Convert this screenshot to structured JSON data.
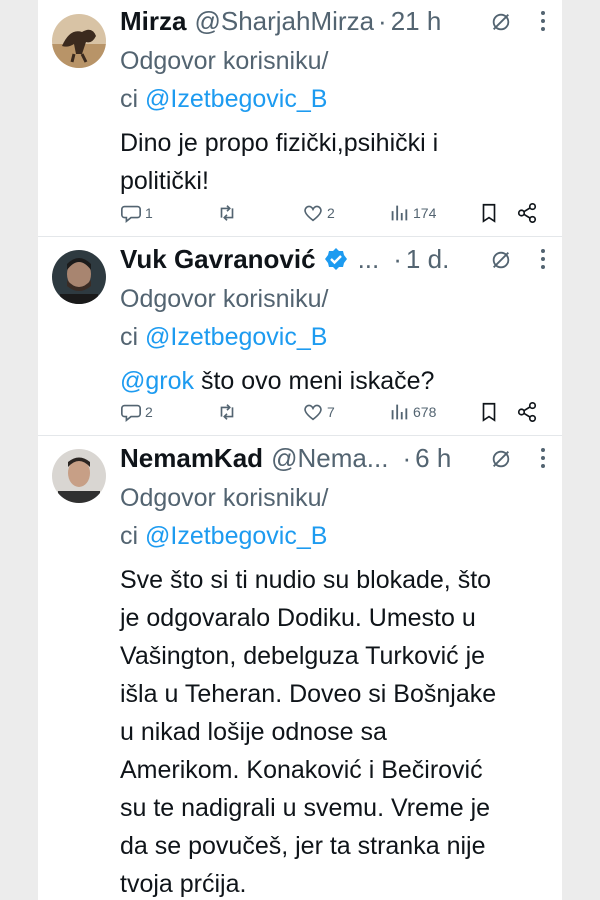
{
  "tweets": [
    {
      "name": "Mirza",
      "handle": "@SharjahMirza",
      "dot": "·",
      "time": "21 h",
      "reply_prefix": "Odgovor korisniku/",
      "reply_line2_prefix": "ci ",
      "reply_mention": "@Izetbegovic_B",
      "text_lines": [
        "Dino je propo  fizički,psihički i",
        "politički!"
      ],
      "replies": "1",
      "reposts": "",
      "likes": "2",
      "views": "174"
    },
    {
      "name": "Vuk Gavranović",
      "handle": "...",
      "dot": "·",
      "time": "1 d.",
      "reply_prefix": "Odgovor korisniku/",
      "reply_line2_prefix": "ci ",
      "reply_mention": "@Izetbegovic_B",
      "text_mention": "@grok",
      "text_rest": " što ovo meni iskače?",
      "replies": "2",
      "reposts": "",
      "likes": "7",
      "views": "678"
    },
    {
      "name": "NemamKad",
      "handle": "@Nema...",
      "dot": "·",
      "time": "6 h",
      "reply_prefix": "Odgovor korisniku/",
      "reply_line2_prefix": "ci ",
      "reply_mention": "@Izetbegovic_B",
      "text_lines": [
        "Sve što si ti nudio su blokade, što",
        "je odgovaralo Dodiku. Umesto u",
        "Vašington, debelguza Turković je",
        "išla u Teheran. Doveo si Bošnjake",
        "u nikad lošije odnose sa",
        "Amerikom. Konaković i Bečirović",
        "su te nadigrali u svemu. Vreme je",
        "da se povučeš, jer ta stranka nije",
        "tvoja prćija."
      ]
    }
  ],
  "icons": {
    "reply": "reply-icon",
    "repost": "repost-icon",
    "like": "heart-icon",
    "views": "views-icon",
    "bookmark": "bookmark-icon",
    "share": "share-icon",
    "grok": "grok-icon",
    "more": "more-icon",
    "verified": "verified-badge-icon"
  },
  "colors": {
    "link": "#1d9bf0",
    "secondary": "#536471",
    "verified": "#1d9bf0"
  }
}
